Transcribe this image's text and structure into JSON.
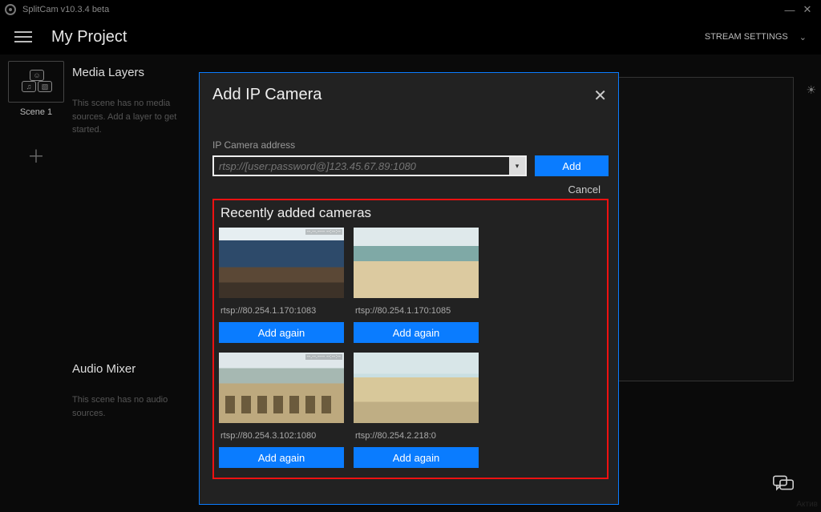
{
  "titlebar": {
    "app_title": "SplitCam v10.3.4 beta"
  },
  "topstrip": {
    "project_title": "My Project",
    "stream_settings_label": "STREAM SETTINGS"
  },
  "scenes": {
    "items": [
      {
        "label": "Scene 1"
      }
    ]
  },
  "media_layers": {
    "title": "Media Layers",
    "empty_text": "This scene has no media sources. Add a layer to get started."
  },
  "audio_mixer": {
    "title": "Audio Mixer",
    "empty_text": "This scene has no audio sources."
  },
  "dialog": {
    "title": "Add IP Camera",
    "address_label": "IP Camera address",
    "address_placeholder": "rtsp://[user:password@]123.45.67.89:1080",
    "add_label": "Add",
    "cancel_label": "Cancel",
    "recent_title": "Recently added cameras",
    "add_again_label": "Add again",
    "cameras": [
      {
        "addr": "rtsp://80.254.1.170:1083"
      },
      {
        "addr": "rtsp://80.254.1.170:1085"
      },
      {
        "addr": "rtsp://80.254.3.102:1080"
      },
      {
        "addr": "rtsp://80.254.2.218:0"
      }
    ]
  },
  "bottom_watermark": "Актив"
}
